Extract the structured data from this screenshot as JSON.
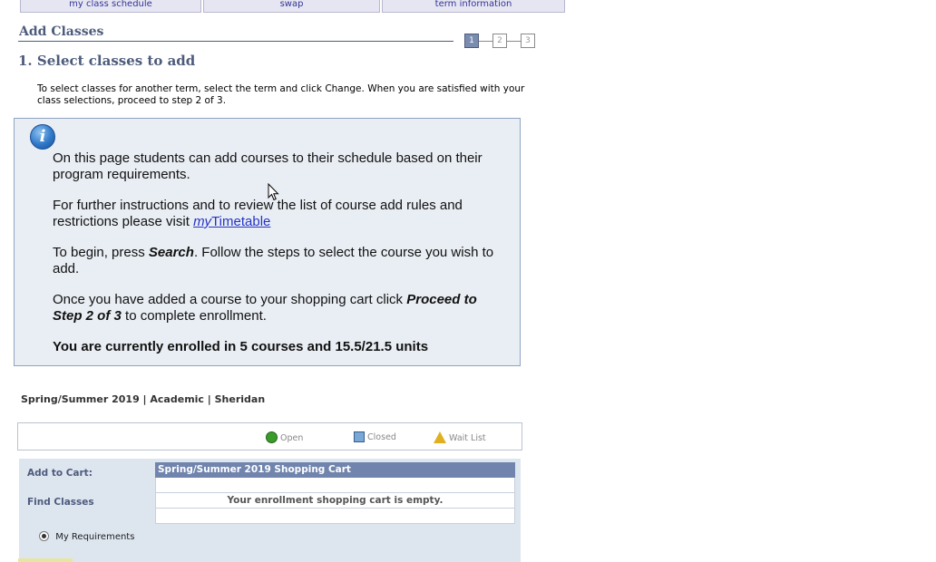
{
  "top_tabs": [
    {
      "label": "my class schedule"
    },
    {
      "label": "swap"
    },
    {
      "label": "term information"
    }
  ],
  "page": {
    "heading": "Add Classes",
    "steps": [
      "1",
      "2",
      "3"
    ],
    "active_step": "1",
    "section_title": "1.  Select classes to add",
    "intro": "To select classes for another term, select the term and click Change.  When you are satisfied with your class selections, proceed to step 2 of 3."
  },
  "info_box": {
    "icon": "info-icon",
    "p1": "On this page students can add courses to their schedule based on their program requirements.",
    "p2_before": "For further instructions and to review the list of course add rules and restrictions please visit ",
    "p2_link_italic": "my",
    "p2_link_rest": "Timetable",
    "p3_before": "To begin, press ",
    "p3_bold": "Search",
    "p3_after": ". Follow the steps to select the course you wish to add.",
    "p4_before": "Once you have added a course to your shopping cart click ",
    "p4_bold": "Proceed to Step 2 of 3",
    "p4_after": " to complete enrollment.",
    "p5": "You are currently enrolled in 5 courses and 15.5/21.5 units"
  },
  "term_line": "Spring/Summer 2019 | Academic | Sheridan",
  "legend": {
    "open": "Open",
    "closed": "Closed",
    "wait_list": "Wait List",
    "open_color": "#3a9b2a",
    "closed_color": "#7aa8d6",
    "wait_color": "#e0b020"
  },
  "cart_panel": {
    "add_to_cart_label": "Add to Cart:",
    "find_classes_label": "Find Classes",
    "radio_label": "My Requirements",
    "cart_header": "Spring/Summer 2019 Shopping Cart",
    "cart_empty": "Your enrollment shopping cart is empty."
  }
}
